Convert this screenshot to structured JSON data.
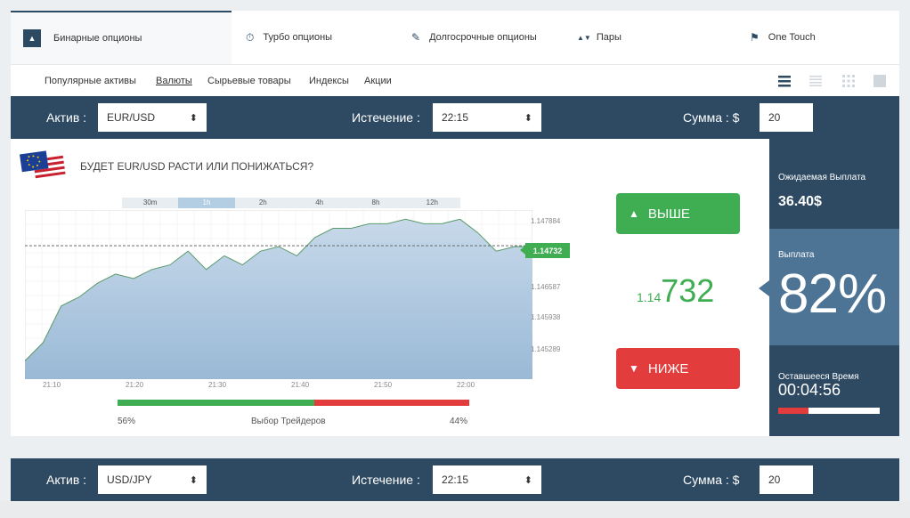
{
  "top_tabs": [
    {
      "label": "Бинарные опционы",
      "icon": "updown-icon"
    },
    {
      "label": "Турбо опционы",
      "icon": "stopwatch-icon"
    },
    {
      "label": "Долгосрочные опционы",
      "icon": "edit-icon"
    },
    {
      "label": "Пары",
      "icon": "pair-arrows-icon",
      "glyph": "▲▼"
    },
    {
      "label": "One Touch",
      "icon": "flag-icon"
    }
  ],
  "sub_tabs": [
    {
      "label": "Популярные активы"
    },
    {
      "label": "Валюты",
      "active": true
    },
    {
      "label": "Сырьевые товары"
    },
    {
      "label": "Индексы"
    },
    {
      "label": "Акции"
    }
  ],
  "view_icons": [
    "list-icon",
    "compact-list-icon",
    "grid-icon",
    "single-icon"
  ],
  "row1": {
    "asset_label": "Актив :",
    "asset_value": "EUR/USD",
    "expiry_label": "Истечение :",
    "expiry_value": "22:15",
    "amount_label": "Сумма : $",
    "amount_value": "20"
  },
  "row2": {
    "asset_label": "Актив :",
    "asset_value": "USD/JPY",
    "expiry_label": "Истечение :",
    "expiry_value": "22:15",
    "amount_label": "Сумма : $",
    "amount_value": "20"
  },
  "question": "БУДЕТ EUR/USD РАСТИ ИЛИ ПОНИЖАТЬСЯ?",
  "timeframes": [
    "30m",
    "1h",
    "2h",
    "4h",
    "8h",
    "12h"
  ],
  "active_timeframe": "1h",
  "current_price_tag": "1.14732",
  "current_price_small": "1.14",
  "current_price_big": "732",
  "btn_up": "ВЫШЕ",
  "btn_down": "НИЖЕ",
  "sentiment": {
    "up_pct": "56%",
    "down_pct": "44%",
    "label": "Выбор Трейдеров",
    "up_value": 56
  },
  "side": {
    "expected_label": "Ожидаемая Выплата",
    "expected_value": "36.40$",
    "payout_label": "Выплата",
    "payout_value": "82%",
    "time_label": "Оставшееся Время",
    "time_value": "00:04:56"
  },
  "colors": {
    "navy": "#2e4a62",
    "green": "#3fae52",
    "red": "#e23c3c",
    "steel": "#4e7495"
  },
  "chart_data": {
    "type": "area",
    "x_ticks": [
      "21:10",
      "21:20",
      "21:30",
      "21:40",
      "21:50",
      "22:00"
    ],
    "y_ticks": [
      "1.147884",
      "1.146587",
      "1.145938",
      "1.145289"
    ],
    "current": 1.14732,
    "x": [
      "21:10",
      "21:12",
      "21:14",
      "21:16",
      "21:18",
      "21:20",
      "21:22",
      "21:24",
      "21:26",
      "21:28",
      "21:30",
      "21:32",
      "21:34",
      "21:36",
      "21:38",
      "21:40",
      "21:42",
      "21:44",
      "21:46",
      "21:48",
      "21:50",
      "21:52",
      "21:54",
      "21:56",
      "21:58",
      "22:00",
      "22:02",
      "22:04",
      "22:05"
    ],
    "y": [
      1.1448,
      1.1452,
      1.146,
      1.1462,
      1.1465,
      1.1467,
      1.1466,
      1.1468,
      1.1469,
      1.1472,
      1.1468,
      1.1471,
      1.1469,
      1.1472,
      1.1473,
      1.1471,
      1.1475,
      1.1477,
      1.1477,
      1.1478,
      1.1478,
      1.1479,
      1.1478,
      1.1478,
      1.1479,
      1.1476,
      1.1472,
      1.1473,
      1.1473
    ]
  }
}
